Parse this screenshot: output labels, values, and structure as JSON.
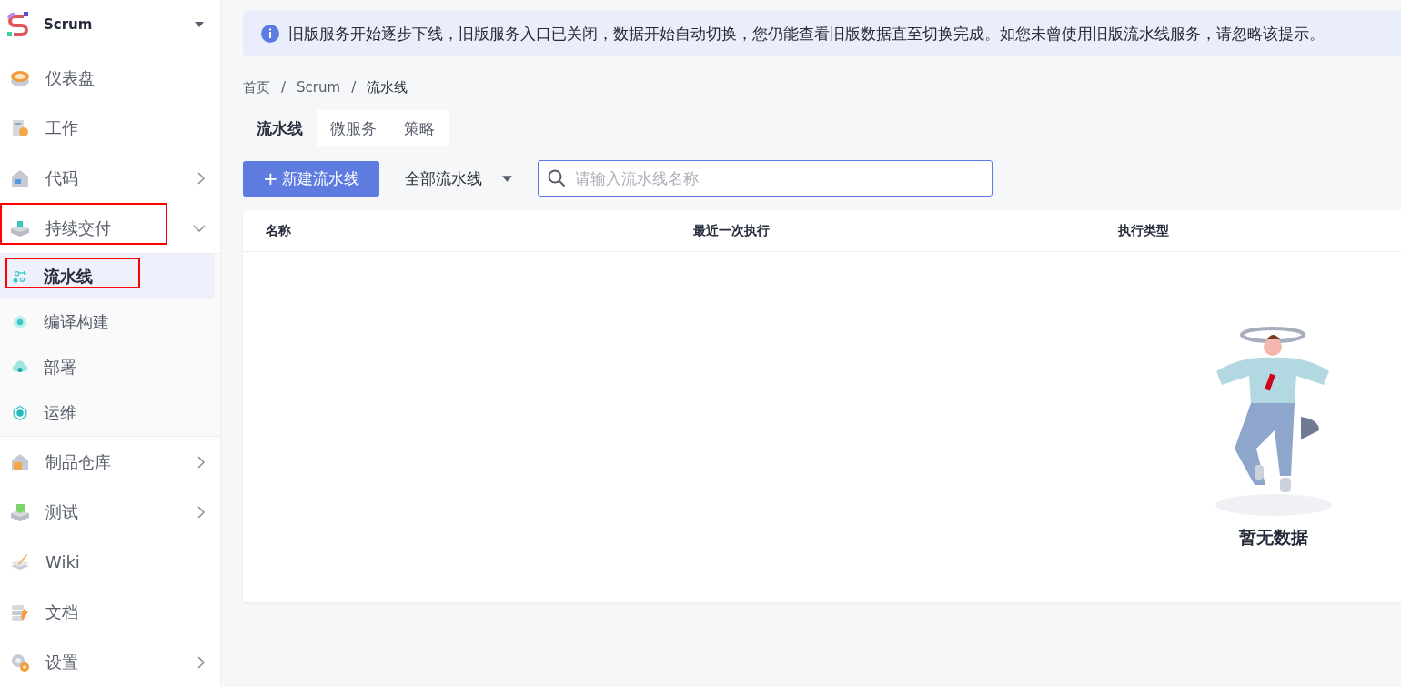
{
  "project": {
    "name": "Scrum"
  },
  "sidebar": {
    "items": [
      {
        "label": "仪表盘",
        "selected": false
      },
      {
        "label": "工作",
        "selected": false
      },
      {
        "label": "代码",
        "selected": false,
        "expanded": false
      },
      {
        "label": "持续交付",
        "selected": false,
        "expanded": true,
        "annotated": true,
        "children": [
          {
            "label": "流水线",
            "selected": true,
            "annotated": true
          },
          {
            "label": "编译构建",
            "selected": false
          },
          {
            "label": "部署",
            "selected": false
          },
          {
            "label": "运维",
            "selected": false
          }
        ]
      },
      {
        "label": "制品仓库",
        "selected": false,
        "expanded": false
      },
      {
        "label": "测试",
        "selected": false,
        "expanded": false
      },
      {
        "label": "Wiki",
        "selected": false
      },
      {
        "label": "文档",
        "selected": false
      },
      {
        "label": "设置",
        "selected": false,
        "expanded": false
      }
    ]
  },
  "notice": "旧版服务开始逐步下线，旧版服务入口已关闭，数据开始自动切换，您仍能查看旧版数据直至切换完成。如您未曾使用旧版流水线服务，请忽略该提示。",
  "breadcrumb": [
    "首页",
    "Scrum",
    "流水线"
  ],
  "breadcrumb_separator": "/",
  "tabs": [
    {
      "label": "流水线",
      "selected": true
    },
    {
      "label": "微服务",
      "selected": false
    },
    {
      "label": "策略",
      "selected": false
    }
  ],
  "toolbar": {
    "new_button": "新建流水线",
    "new_button_icon": "+",
    "filter": "全部流水线",
    "search": {
      "placeholder": "请输入流水线名称"
    }
  },
  "table": {
    "columns": [
      "名称",
      "最近一次执行",
      "执行类型"
    ],
    "empty_text": "暂无数据"
  }
}
